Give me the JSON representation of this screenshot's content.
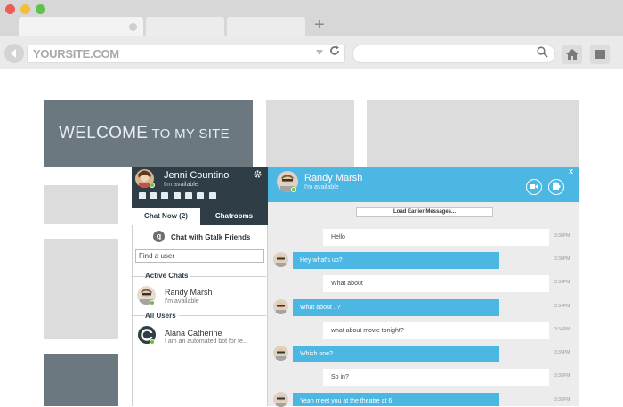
{
  "browser": {
    "url": "YOURSITE.COM",
    "new_tab_label": "+"
  },
  "page": {
    "welcome_big": "WELCOME",
    "welcome_small": " TO MY SITE"
  },
  "chat_sidebar": {
    "user_name": "Jenni Countino",
    "user_status": "I'm available",
    "tabs": [
      "Chat Now (2)",
      "Chatrooms"
    ],
    "gtalk_label": "Chat with Gtalk Friends",
    "search_value": "Find a user",
    "active_chats_label": "Active Chats",
    "all_users_label": "All Users",
    "active_chats": [
      {
        "name": "Randy Marsh",
        "status": "I'm available"
      }
    ],
    "all_users": [
      {
        "name": "Alana Catherine",
        "status": "I am an automated bot for te..."
      }
    ]
  },
  "conversation": {
    "contact_name": "Randy Marsh",
    "contact_status": "I'm available",
    "close_label": "x",
    "load_earlier": "Load Earlier Messages...",
    "messages": [
      {
        "dir": "in",
        "text": "Hello",
        "time": "3:38PM"
      },
      {
        "dir": "out",
        "text": "Hey what's up?",
        "time": "3:38PM"
      },
      {
        "dir": "in",
        "text": "What about",
        "time": "3:33PM"
      },
      {
        "dir": "out",
        "text": "What about ..?",
        "time": "3:34PM"
      },
      {
        "dir": "in",
        "text": "what about movie tonight?",
        "time": "3:34PM"
      },
      {
        "dir": "out",
        "text": "Which one?",
        "time": "3:35PM"
      },
      {
        "dir": "in",
        "text": "So in?",
        "time": "3:35PM"
      },
      {
        "dir": "out",
        "text": "Yeah meet you at the theatre at 6",
        "time": "3:35PM"
      }
    ]
  },
  "colors": {
    "accent": "#4db7e3",
    "dark": "#2f3d46",
    "online": "#6dbd45"
  }
}
